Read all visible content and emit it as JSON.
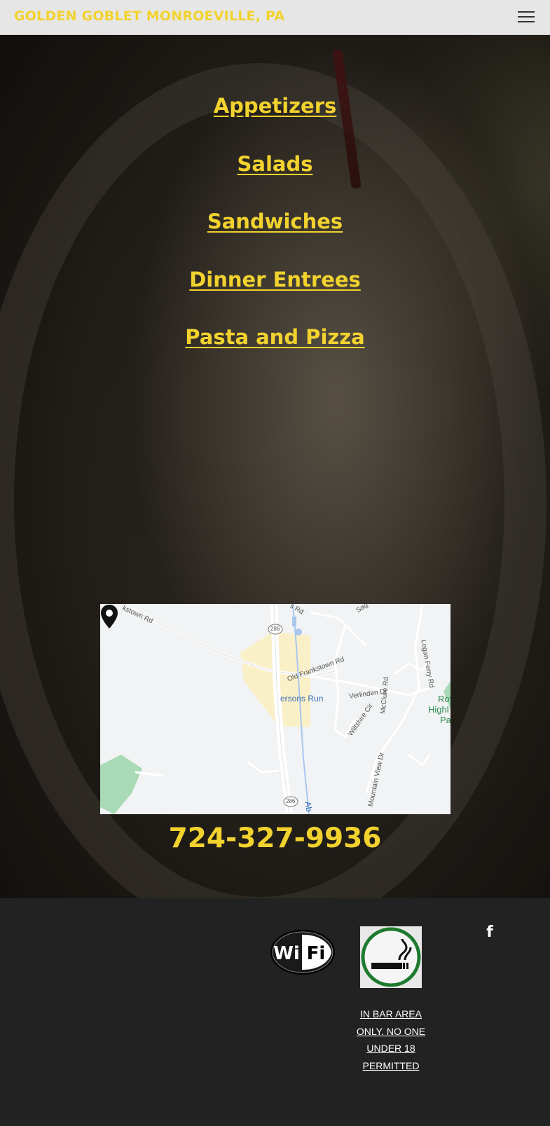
{
  "header": {
    "site_title": "GOLDEN GOBLET MONROEVILLE, PA",
    "menu_icon": "hamburger-menu-icon"
  },
  "menu_links": [
    {
      "label": "Appetizers"
    },
    {
      "label": "Salads"
    },
    {
      "label": "Sandwiches"
    },
    {
      "label": "Dinner Entrees"
    },
    {
      "label": "Pasta and Pizza"
    }
  ],
  "map": {
    "labels": {
      "frankstown_rd": "kstown Rd",
      "top_rd": "s Rd",
      "top_sa": "Sag",
      "route_286_top": "286",
      "old_frankstown": "Old Frankstown Rd",
      "logan_ferry": "Logan Ferry Rd",
      "verlinden": "Verlinden Dr",
      "mcclure": "McClure Rd",
      "wiltshire": "Wiltshire Cir",
      "pattersons_run": "ersons Run",
      "park_1": "Roy",
      "park_2": "Highl",
      "park_3": "Pa",
      "mountain_view": "Mountain View Dr",
      "route_286_bottom": "286",
      "creek": "Ab"
    },
    "pin_icon": "map-pin-icon"
  },
  "phone": "724-327-9936",
  "footer": {
    "wifi_logo_text": {
      "wi": "Wi",
      "fi": "Fi"
    },
    "wifi_icon": "wifi-logo-icon",
    "smoking_icon": "smoking-area-icon",
    "smoking_notice": "IN BAR AREA ONLY. NO ONE UNDER 18 PERMITTED",
    "facebook_icon": "facebook-icon",
    "facebook_glyph": "f"
  },
  "colors": {
    "accent": "#f2d22e",
    "header_bg": "#e6e6e6",
    "footer_bg": "#222222"
  }
}
